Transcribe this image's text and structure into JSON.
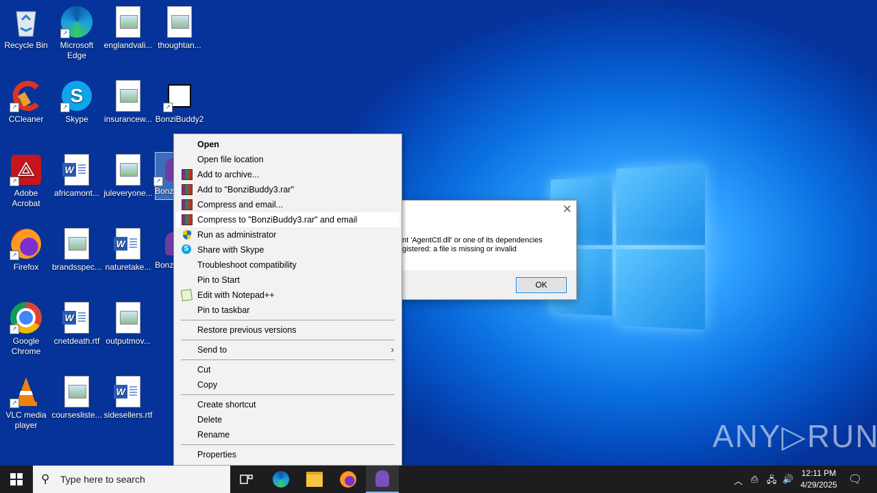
{
  "desktop_icons": [
    {
      "label": "Recycle Bin"
    },
    {
      "label": "Microsoft Edge"
    },
    {
      "label": "englandvali..."
    },
    {
      "label": "thoughtan..."
    },
    {
      "label": "CCleaner"
    },
    {
      "label": "Skype"
    },
    {
      "label": "insurancew..."
    },
    {
      "label": "BonziBuddy2"
    },
    {
      "label": "Adobe Acrobat"
    },
    {
      "label": "africamont..."
    },
    {
      "label": "juleveryone..."
    },
    {
      "label": "Bonz"
    },
    {
      "label": "Firefox"
    },
    {
      "label": "brandsspec..."
    },
    {
      "label": "naturetake..."
    },
    {
      "label": "Bonz"
    },
    {
      "label": "Google Chrome"
    },
    {
      "label": "cnetdeath.rtf"
    },
    {
      "label": "outputmov..."
    },
    {
      "label": "VLC media player"
    },
    {
      "label": "coursesliste..."
    },
    {
      "label": "sidesellers.rtf"
    }
  ],
  "dialog": {
    "close": "✕",
    "line1": "nt 'AgentCtl.dll' or one of its dependencies",
    "line2": "gistered: a file is missing or invalid",
    "ok": "OK"
  },
  "context_menu": {
    "items": [
      {
        "label": "Open"
      },
      {
        "label": "Open file location"
      },
      {
        "label": "Add to archive..."
      },
      {
        "label": "Add to \"BonziBuddy3.rar\""
      },
      {
        "label": "Compress and email..."
      },
      {
        "label": "Compress to \"BonziBuddy3.rar\" and email"
      },
      {
        "label": "Run as administrator"
      },
      {
        "label": "Share with Skype"
      },
      {
        "label": "Troubleshoot compatibility"
      },
      {
        "label": "Pin to Start"
      },
      {
        "label": "Edit with Notepad++"
      },
      {
        "label": "Pin to taskbar"
      },
      {
        "label": "Restore previous versions"
      },
      {
        "label": "Send to"
      },
      {
        "label": "Cut"
      },
      {
        "label": "Copy"
      },
      {
        "label": "Create shortcut"
      },
      {
        "label": "Delete"
      },
      {
        "label": "Rename"
      },
      {
        "label": "Properties"
      }
    ]
  },
  "taskbar": {
    "search_placeholder": "Type here to search",
    "time": "12:11 PM",
    "date": "4/29/2025"
  },
  "watermark": "ANY▷RUN"
}
